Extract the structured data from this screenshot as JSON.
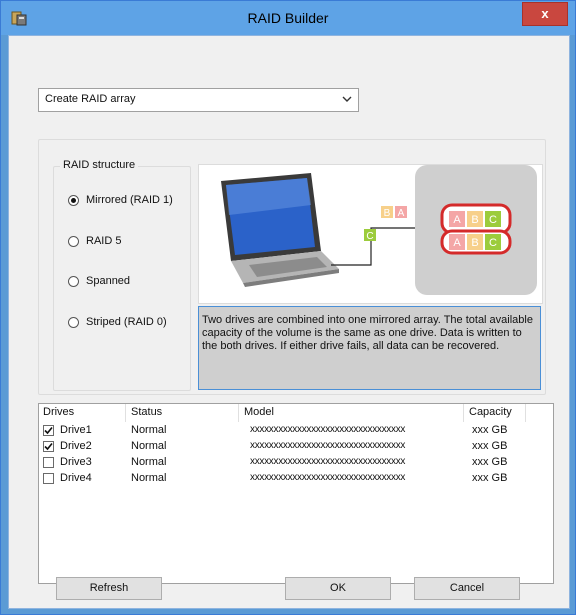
{
  "window": {
    "title": "RAID Builder",
    "close_label": "x"
  },
  "action_select": {
    "value": "Create RAID array"
  },
  "raid_structure": {
    "legend": "RAID structure",
    "options": [
      {
        "label": "Mirrored (RAID 1)",
        "selected": true
      },
      {
        "label": "RAID 5",
        "selected": false
      },
      {
        "label": "Spanned",
        "selected": false
      },
      {
        "label": "Striped (RAID 0)",
        "selected": false
      }
    ]
  },
  "illustration": {
    "blocks": [
      "A",
      "B",
      "C"
    ],
    "colors": {
      "A": "#f4a6a6",
      "B": "#f7d08a",
      "C": "#9ccc3c",
      "ring": "#d42a2a"
    }
  },
  "description": "Two drives are combined into one mirrored array. The total available capacity of the volume is the same as one drive. Data is written to the both drives. If either drive fails, all data can be recovered.",
  "drives": {
    "columns": {
      "name": "Drives",
      "status": "Status",
      "model": "Model",
      "capacity": "Capacity"
    },
    "rows": [
      {
        "name": "Drive1",
        "status": "Normal",
        "model": "xxxxxxxxxxxxxxxxxxxxxxxxxxxxxxxxx",
        "capacity": "xxx GB",
        "checked": true
      },
      {
        "name": "Drive2",
        "status": "Normal",
        "model": "xxxxxxxxxxxxxxxxxxxxxxxxxxxxxxxxx",
        "capacity": "xxx GB",
        "checked": true
      },
      {
        "name": "Drive3",
        "status": "Normal",
        "model": "xxxxxxxxxxxxxxxxxxxxxxxxxxxxxxxxx",
        "capacity": "xxx GB",
        "checked": false
      },
      {
        "name": "Drive4",
        "status": "Normal",
        "model": "xxxxxxxxxxxxxxxxxxxxxxxxxxxxxxxxx",
        "capacity": "xxx GB",
        "checked": false
      }
    ]
  },
  "buttons": {
    "refresh": "Refresh",
    "ok": "OK",
    "cancel": "Cancel"
  }
}
